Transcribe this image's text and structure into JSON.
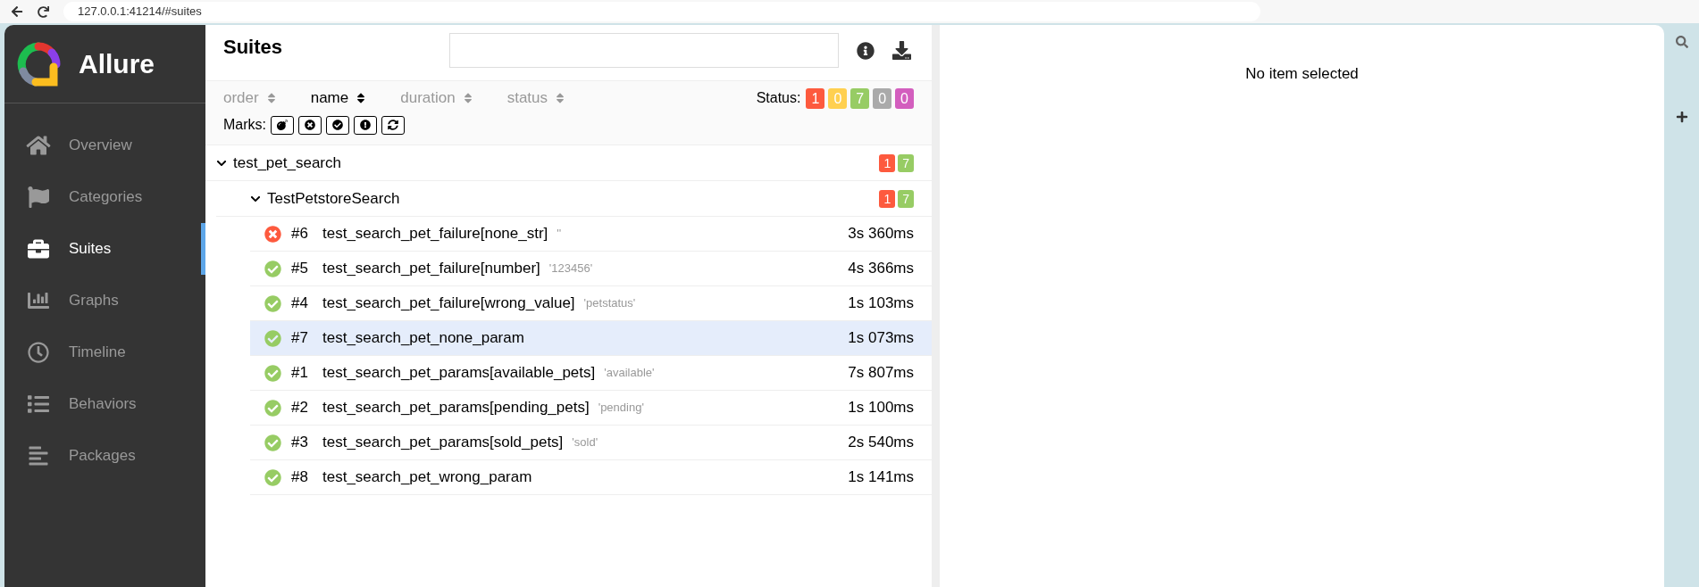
{
  "browser": {
    "url": "127.0.0.1:41214/#suites"
  },
  "sidebar": {
    "brand": "Allure",
    "items": [
      {
        "label": "Overview",
        "selected": false
      },
      {
        "label": "Categories",
        "selected": false
      },
      {
        "label": "Suites",
        "selected": true
      },
      {
        "label": "Graphs",
        "selected": false
      },
      {
        "label": "Timeline",
        "selected": false
      },
      {
        "label": "Behaviors",
        "selected": false
      },
      {
        "label": "Packages",
        "selected": false
      }
    ]
  },
  "suites": {
    "title": "Suites",
    "sort_columns": [
      {
        "label": "order",
        "selected": false
      },
      {
        "label": "name",
        "selected": true
      },
      {
        "label": "duration",
        "selected": false
      },
      {
        "label": "status",
        "selected": false
      }
    ],
    "status_label": "Status:",
    "status_counts": [
      {
        "count": "1",
        "color": "#fd5a3e"
      },
      {
        "count": "0",
        "color": "#ffd050"
      },
      {
        "count": "7",
        "color": "#97cc64"
      },
      {
        "count": "0",
        "color": "#aaaaaa"
      },
      {
        "count": "0",
        "color": "#d35ebe"
      }
    ],
    "marks_label": "Marks:",
    "tree": [
      {
        "name": "test_pet_search",
        "expanded": true,
        "counts": [
          {
            "count": "1",
            "color": "#fd5a3e"
          },
          {
            "count": "7",
            "color": "#97cc64"
          }
        ],
        "children": [
          {
            "name": "TestPetstoreSearch",
            "expanded": true,
            "counts": [
              {
                "count": "1",
                "color": "#fd5a3e"
              },
              {
                "count": "7",
                "color": "#97cc64"
              }
            ],
            "tests": [
              {
                "kind": "failed",
                "number": "#6",
                "name": "test_search_pet_failure[none_str]",
                "param": "''",
                "duration": "3s 360ms",
                "selected": false
              },
              {
                "kind": "passed",
                "number": "#5",
                "name": "test_search_pet_failure[number]",
                "param": "'123456'",
                "duration": "4s 366ms",
                "selected": false
              },
              {
                "kind": "passed",
                "number": "#4",
                "name": "test_search_pet_failure[wrong_value]",
                "param": "'petstatus'",
                "duration": "1s 103ms",
                "selected": false
              },
              {
                "kind": "passed",
                "number": "#7",
                "name": "test_search_pet_none_param",
                "duration": "1s 073ms",
                "selected": true
              },
              {
                "kind": "passed",
                "number": "#1",
                "name": "test_search_pet_params[available_pets]",
                "param": "'available'",
                "duration": "7s 807ms",
                "selected": false
              },
              {
                "kind": "passed",
                "number": "#2",
                "name": "test_search_pet_params[pending_pets]",
                "param": "'pending'",
                "duration": "1s 100ms",
                "selected": false
              },
              {
                "kind": "passed",
                "number": "#3",
                "name": "test_search_pet_params[sold_pets]",
                "param": "'sold'",
                "duration": "2s 540ms",
                "selected": false
              },
              {
                "kind": "passed",
                "number": "#8",
                "name": "test_search_pet_wrong_param",
                "duration": "1s 141ms",
                "selected": false
              }
            ]
          }
        ]
      }
    ]
  },
  "detail": {
    "empty_text": "No item selected"
  }
}
